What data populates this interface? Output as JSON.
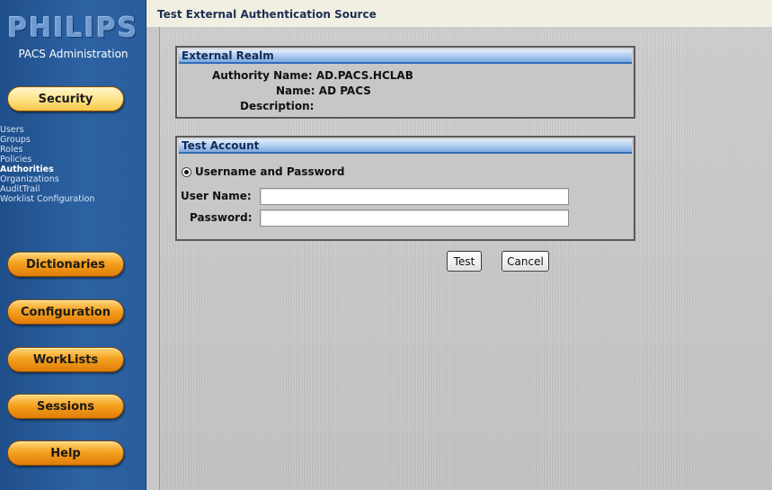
{
  "sidebar": {
    "brand": "PHILIPS",
    "subtitle": "PACS Administration",
    "sections": {
      "security": "Security",
      "dictionaries": "Dictionaries",
      "configuration": "Configuration",
      "worklists": "WorkLists",
      "sessions": "Sessions",
      "help": "Help"
    },
    "security_links": [
      {
        "label": "Users"
      },
      {
        "label": "Groups"
      },
      {
        "label": "Roles"
      },
      {
        "label": "Policies"
      },
      {
        "label": "Authorities"
      },
      {
        "label": "Organizations"
      },
      {
        "label": "AuditTrail"
      },
      {
        "label": "Worklist Configuration"
      }
    ],
    "current_link": "Authorities"
  },
  "header": {
    "title": "Test External Authentication Source"
  },
  "realm": {
    "title": "External Realm",
    "authority_label": "Authority Name:",
    "authority_value": "AD.PACS.HCLAB",
    "name_label": "Name:",
    "name_value": "AD PACS",
    "description_label": "Description:",
    "description_value": ""
  },
  "account": {
    "title": "Test Account",
    "mode_label": "Username and Password",
    "username_label": "User Name:",
    "username_value": "",
    "password_label": "Password:",
    "password_value": ""
  },
  "actions": {
    "test": "Test",
    "cancel": "Cancel"
  },
  "colors": {
    "sidebar": "#2c62a3",
    "accent_pill": "#f5a21f",
    "panel_header": "#a9c9ef"
  }
}
